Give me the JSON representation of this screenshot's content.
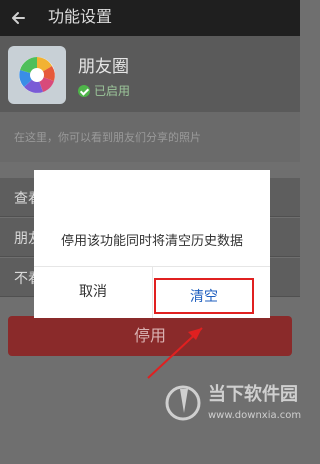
{
  "header": {
    "title": "功能设置"
  },
  "app": {
    "name": "朋友圈",
    "status": "已启用"
  },
  "description": "在这里，你可以看到朋友们分享的照片",
  "items": [
    {
      "label": "查看朋友们的照片"
    },
    {
      "label": "朋友圈"
    },
    {
      "label": "不看"
    }
  ],
  "disable_button": "停用",
  "dialog": {
    "message": "停用该功能同时将清空历史数据",
    "cancel": "取消",
    "confirm": "清空"
  },
  "watermark": {
    "title": "当下软件园",
    "url": "www.downxia.com"
  },
  "colors": {
    "highlight": "#e02020",
    "dialog_confirm": "#1f5fbf",
    "enabled": "#4fb54a"
  }
}
